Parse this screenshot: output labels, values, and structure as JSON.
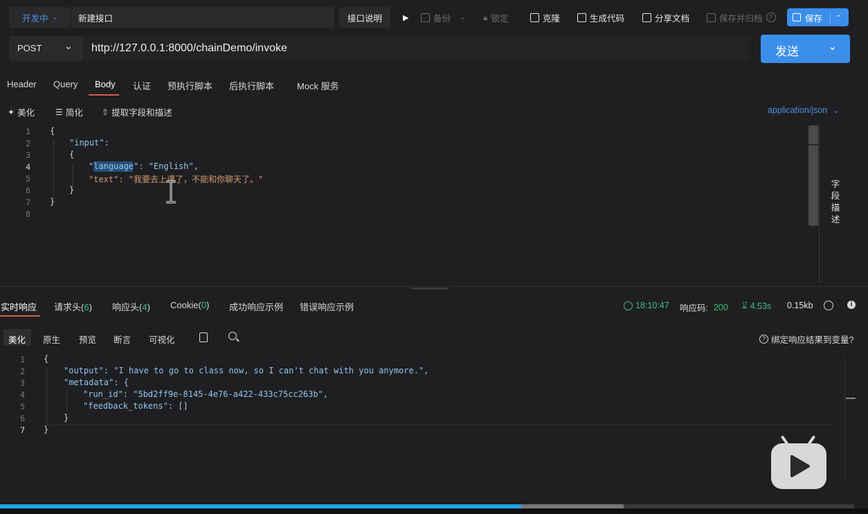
{
  "topbar": {
    "status_label": "开发中",
    "title_value": "新建接口",
    "doc_button": "接口说明",
    "backup_label": "备份",
    "lock_label": "锁定",
    "clone_label": "克隆",
    "gen_code_label": "生成代码",
    "share_doc_label": "分享文档",
    "save_archive_label": "保存并归档",
    "save_label": "保存"
  },
  "request": {
    "method": "POST",
    "url": "http://127.0.0.1:8000/chainDemo/invoke",
    "send_label": "发送"
  },
  "request_tabs": [
    "Header",
    "Query",
    "Body",
    "认证",
    "预执行脚本",
    "后执行脚本",
    "Mock 服务"
  ],
  "body_toolbar": {
    "beautify": "美化",
    "simplify": "简化",
    "extract": "提取字段和描述",
    "content_type": "application/json"
  },
  "side_panel_label": "字段描述",
  "request_body": {
    "line_numbers": [
      "1",
      "2",
      "3",
      "4",
      "5",
      "6",
      "7",
      "8"
    ],
    "lines": [
      "{",
      "\"input\":",
      "{",
      "\"language\": \"English\",",
      "\"text\": \"我要去上课了，不能和你聊天了。\"",
      "}",
      "}",
      ""
    ]
  },
  "response_tabs": {
    "realtime": "实时响应",
    "req_headers": "请求头",
    "req_headers_count": "6",
    "resp_headers": "响应头",
    "resp_headers_count": "4",
    "cookie": "Cookie",
    "cookie_count": "0",
    "success_example": "成功响应示例",
    "error_example": "错误响应示例"
  },
  "response_status": {
    "time": "18:10:47",
    "code_label": "响应码:",
    "code": "200",
    "duration": "4.53s",
    "size": "0.15kb"
  },
  "response_view_tabs": [
    "美化",
    "原生",
    "预览",
    "断言",
    "可视化"
  ],
  "bind_var_label": "绑定响应结果到变量?",
  "response_body": {
    "line_numbers": [
      "1",
      "2",
      "3",
      "4",
      "5",
      "6",
      "7"
    ],
    "lines": [
      "{",
      "\"output\": \"I have to go to class now, so I can't chat with you anymore.\",",
      "\"metadata\": {",
      "\"run_id\": \"5bd2ff9e-8145-4e76-a422-433c75cc263b\",",
      "\"feedback_tokens\": []",
      "}",
      "}"
    ]
  },
  "video": {
    "progress": 0.61,
    "buffered": 0.73
  },
  "colors": {
    "accent": "#3b8eea",
    "status_green": "#3fbf7f",
    "key": "#8fc6f2",
    "string": "#d59a6f"
  }
}
